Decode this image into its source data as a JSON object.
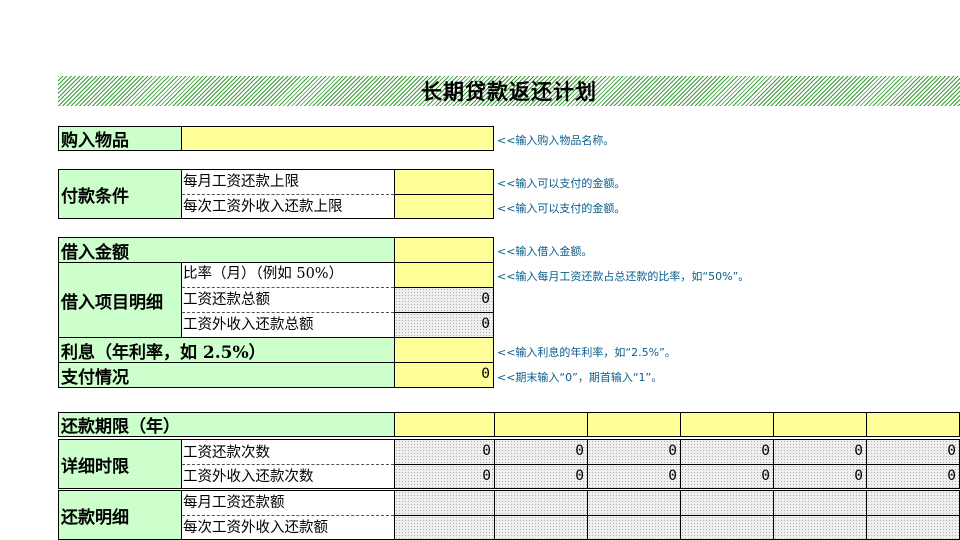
{
  "title": "长期贷款返还计划",
  "purchase": {
    "label": "购入物品",
    "hint": "<<输入购入物品名称。"
  },
  "payment": {
    "label": "付款条件",
    "rows": [
      {
        "label": "每月工资还款上限",
        "hint": "<<输入可以支付的金额。"
      },
      {
        "label": "每次工资外收入还款上限",
        "hint": "<<输入可以支付的金额。"
      }
    ]
  },
  "borrow_amount": {
    "label": "借入金额",
    "hint": "<<输入借入金额。"
  },
  "borrow_detail": {
    "label": "借入项目明细",
    "rows": [
      {
        "label": "比率（月）（例如 50%）",
        "value": "",
        "hint": "<<输入每月工资还款占总还款的比率，如“50%”。"
      },
      {
        "label": "工资还款总额",
        "value": "0"
      },
      {
        "label": "工资外收入还款总额",
        "value": "0"
      }
    ]
  },
  "interest": {
    "label": "利息（年利率，如 2.5%）",
    "hint": "<<输入利息的年利率，如“2.5%”。"
  },
  "payment_status": {
    "label": "支付情况",
    "value": "0",
    "hint": "<<期末输入“0”，期首输入“1”。"
  },
  "term": {
    "label": "还款期限（年）"
  },
  "schedule": {
    "label": "详细时限",
    "rows": [
      {
        "label": "工资还款次数",
        "values": [
          "0",
          "0",
          "0",
          "0",
          "0",
          "0"
        ]
      },
      {
        "label": "工资外收入还款次数",
        "values": [
          "0",
          "0",
          "0",
          "0",
          "0",
          "0"
        ]
      }
    ]
  },
  "repay_detail": {
    "label": "还款明细",
    "rows": [
      {
        "label": "每月工资还款额"
      },
      {
        "label": "每次工资外收入还款额"
      }
    ]
  },
  "colors": {
    "label_bg": "#ccffcc",
    "input_bg": "#ffff99",
    "hint_text": "#0a5c8a",
    "title_stripe": "#3a9c3a"
  }
}
